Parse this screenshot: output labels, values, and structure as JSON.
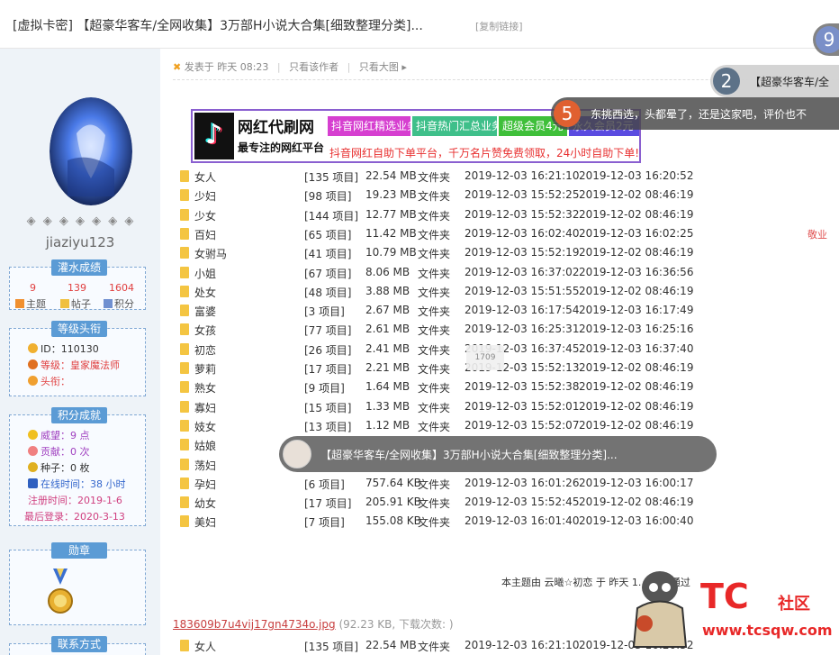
{
  "header": {
    "title": "[虚拟卡密] 【超豪华客车/全网收集】3万部H小说大合集[细致整理分类]...",
    "copy_link": "[复制链接]"
  },
  "sidebar": {
    "diamonds": "◈ ◈ ◈ ◈ ◈ ◈ ◈",
    "username": "jiaziyu123",
    "stats_tag": "灌水成绩",
    "stats": {
      "topics": "9",
      "posts": "139",
      "points": "1604",
      "topics_label": "主题",
      "posts_label": "帖子",
      "points_label": "积分"
    },
    "rank_tag": "等级头衔",
    "id_row": "ID：110130",
    "level_row": "等级：皇家魔法师",
    "title_row": "头衔：",
    "credits_tag": "积分成就",
    "prestige": "威望：9 点",
    "contribution": "贡献：0 次",
    "seeds": "种子：0 枚",
    "online": "在线时间：38 小时",
    "register": "注册时间：2019-1-6",
    "lastlogin": "最后登录：2020-3-13",
    "medal_tag": "勋章",
    "contact_tag": "联系方式"
  },
  "post": {
    "meta_posted": "发表于 昨天 08:23",
    "meta_author_only": "只看该作者",
    "meta_big_image": "只看大图"
  },
  "banner": {
    "brand": "网红代刷网",
    "brand_sub": "最专注的网红平台",
    "tag1": "抖音网红精选业务",
    "tag2": "抖音热门汇总业务",
    "tag3": "超级会员4元",
    "tag4": "永久会员2元",
    "bottom": "抖音网红自助下单平台，千万名片赞免费领取，24小时自助下单!"
  },
  "files": [
    {
      "name": "女人",
      "count": "[135 项目]",
      "size": "22.54 MB",
      "type": "文件夹",
      "d1": "2019-12-03 16:21:10",
      "d2": "2019-12-03 16:20:52"
    },
    {
      "name": "少妇",
      "count": "[98 项目]",
      "size": "19.23 MB",
      "type": "文件夹",
      "d1": "2019-12-03 15:52:25",
      "d2": "2019-12-02 08:46:19"
    },
    {
      "name": "少女",
      "count": "[144 项目]",
      "size": "12.77 MB",
      "type": "文件夹",
      "d1": "2019-12-03 15:52:32",
      "d2": "2019-12-02 08:46:19"
    },
    {
      "name": "百妇",
      "count": "[65 项目]",
      "size": "11.42 MB",
      "type": "文件夹",
      "d1": "2019-12-03 16:02:40",
      "d2": "2019-12-03 16:02:25"
    },
    {
      "name": "女驸马",
      "count": "[41 项目]",
      "size": "10.79 MB",
      "type": "文件夹",
      "d1": "2019-12-03 15:52:19",
      "d2": "2019-12-02 08:46:19"
    },
    {
      "name": "小姐",
      "count": "[67 项目]",
      "size": "8.06 MB",
      "type": "文件夹",
      "d1": "2019-12-03 16:37:02",
      "d2": "2019-12-03 16:36:56"
    },
    {
      "name": "处女",
      "count": "[48 项目]",
      "size": "3.88 MB",
      "type": "文件夹",
      "d1": "2019-12-03 15:51:55",
      "d2": "2019-12-02 08:46:19"
    },
    {
      "name": "富婆",
      "count": "[3 项目]",
      "size": "2.67 MB",
      "type": "文件夹",
      "d1": "2019-12-03 16:17:54",
      "d2": "2019-12-03 16:17:49"
    },
    {
      "name": "女孩",
      "count": "[77 项目]",
      "size": "2.61 MB",
      "type": "文件夹",
      "d1": "2019-12-03 16:25:31",
      "d2": "2019-12-03 16:25:16"
    },
    {
      "name": "初恋",
      "count": "[26 项目]",
      "size": "2.41 MB",
      "type": "文件夹",
      "d1": "2019-12-03 16:37:45",
      "d2": "2019-12-03 16:37:40"
    },
    {
      "name": "萝莉",
      "count": "[17 项目]",
      "size": "2.21 MB",
      "type": "文件夹",
      "d1": "2019-12-03 15:52:13",
      "d2": "2019-12-02 08:46:19"
    },
    {
      "name": "熟女",
      "count": "[9 项目]",
      "size": "1.64 MB",
      "type": "文件夹",
      "d1": "2019-12-03 15:52:38",
      "d2": "2019-12-02 08:46:19"
    },
    {
      "name": "寡妇",
      "count": "[15 项目]",
      "size": "1.33 MB",
      "type": "文件夹",
      "d1": "2019-12-03 15:52:01",
      "d2": "2019-12-02 08:46:19"
    },
    {
      "name": "妓女",
      "count": "[13 项目]",
      "size": "1.12 MB",
      "type": "文件夹",
      "d1": "2019-12-03 15:52:07",
      "d2": "2019-12-02 08:46:19"
    },
    {
      "name": "姑娘",
      "count": "",
      "size": "",
      "type": "",
      "d1": "",
      "d2": ""
    },
    {
      "name": "荡妇",
      "count": "",
      "size": "",
      "type": "",
      "d1": "",
      "d2": ""
    },
    {
      "name": "孕妇",
      "count": "[6 项目]",
      "size": "757.64 KB",
      "type": "文件夹",
      "d1": "2019-12-03 16:01:26",
      "d2": "2019-12-03 16:00:17"
    },
    {
      "name": "幼女",
      "count": "[17 项目]",
      "size": "205.91 KB",
      "type": "文件夹",
      "d1": "2019-12-03 15:52:45",
      "d2": "2019-12-02 08:46:19"
    },
    {
      "name": "美妇",
      "count": "[7 项目]",
      "size": "155.08 KB",
      "type": "文件夹",
      "d1": "2019-12-03 16:01:40",
      "d2": "2019-12-03 16:00:40"
    }
  ],
  "last_row": {
    "name": "女人",
    "count": "[135 项目]",
    "size": "22.54 MB",
    "type": "文件夹",
    "d1": "2019-12-03 16:21:10",
    "d2": "2019-12-03 16:20:52"
  },
  "overlays": {
    "small_mark": "1709",
    "pill_text": "【超豪华客车/全网收集】3万部H小说大合集[细致整理分类]...",
    "danmu9_num": "9",
    "danmu2_num": "2",
    "danmu2_text": "【超豪华客车/全",
    "danmu5_num": "5",
    "danmu5_text": "东挑西选，头都晕了，还是这家吧，评价也不"
  },
  "respect": "敬业",
  "review": "本主题由 云曦☆初恋 于 昨天 1... 审核通过",
  "attachment": {
    "file": "183609b7u4vij17gn4734o.jpg",
    "meta": "(92.23 KB, 下载次数: )"
  },
  "logo": {
    "tc": "TC",
    "cn": "社区",
    "url": "www.tcsqw.com"
  }
}
